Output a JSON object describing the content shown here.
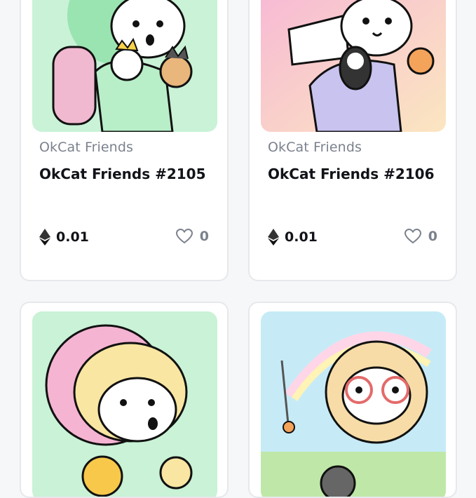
{
  "cards": [
    {
      "collection": "OkCat Friends",
      "title": "OkCat Friends #2105",
      "price": "0.01",
      "likes": "0",
      "bg": "#c9f2d6",
      "accent": "#9ae4b1"
    },
    {
      "collection": "OkCat Friends",
      "title": "OkCat Friends #2106",
      "price": "0.01",
      "likes": "0",
      "bg": "#f7c6dd",
      "accent": "#c8c3ef"
    },
    {
      "bg": "#c9f2d6",
      "accent": "#f8e6a2"
    },
    {
      "bg": "#c6ebf7",
      "accent": "#f7dca7"
    }
  ],
  "icons": {
    "currency": "ethereum-icon",
    "like": "heart-outline-icon"
  }
}
